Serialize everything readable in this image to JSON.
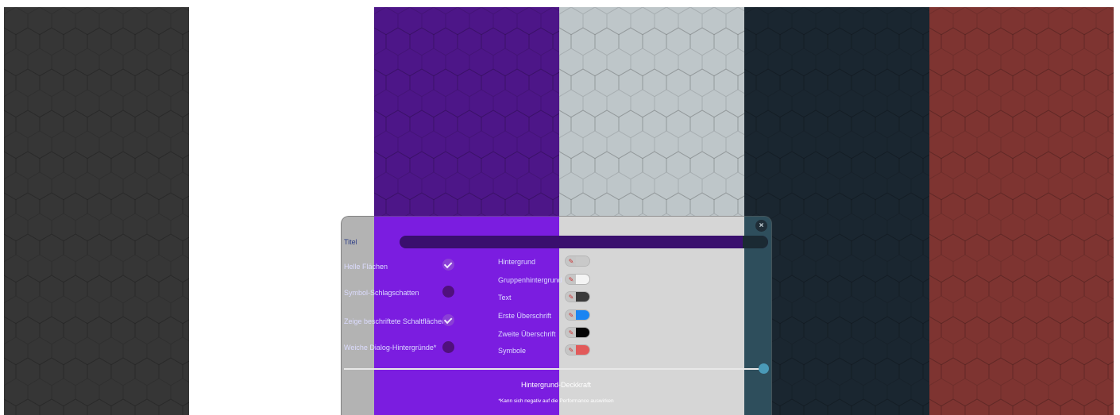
{
  "theme_previews": [
    {
      "name": "dark-grey",
      "color": "#363636"
    },
    {
      "name": "white",
      "color": "#ffffff"
    },
    {
      "name": "purple",
      "color": "#4d1688"
    },
    {
      "name": "light-grey",
      "color": "#bec6c9"
    },
    {
      "name": "dark-slate",
      "color": "#1a2630"
    },
    {
      "name": "red",
      "color": "#7e3431"
    }
  ],
  "dialog": {
    "close_icon": "×",
    "title_label": "Titel",
    "title_value": "",
    "checkboxes": [
      {
        "label": "Helle Flächen",
        "checked": true
      },
      {
        "label": "Symbol-Schlagschatten",
        "checked": false
      },
      {
        "label": "Zeige beschriftete Schaltflächen",
        "checked": true
      },
      {
        "label": "Weiche Dialog-Hintergründe*",
        "checked": false
      }
    ],
    "colors": [
      {
        "label": "Hintergrund",
        "color": "#c9c9c9"
      },
      {
        "label": "Gruppenhintergrund",
        "color": "#f4f4f4"
      },
      {
        "label": "Text",
        "color": "#3a3a3a"
      },
      {
        "label": "Erste Überschrift",
        "color": "#1a84f2"
      },
      {
        "label": "Zweite Überschrift",
        "color": "#050505"
      },
      {
        "label": "Symbole",
        "color": "#e25a5a"
      }
    ],
    "slider_label": "Hintergrund-Deckkraft",
    "slider_value": 1.0,
    "footnote": "*Kann sich negativ auf die Performance auswirken"
  }
}
